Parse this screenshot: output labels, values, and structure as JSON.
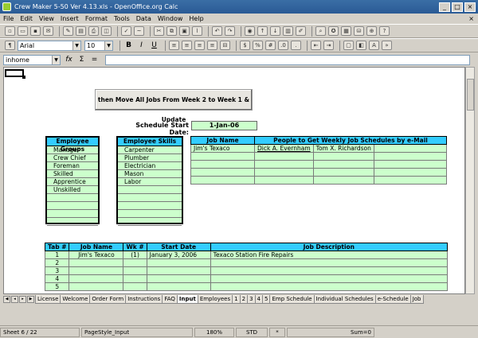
{
  "window": {
    "title": "Crew Maker 5-50 Ver 4.13.xls - OpenOffice.org Calc",
    "minimize": "_",
    "maximize": "□",
    "close": "×"
  },
  "menu": [
    "File",
    "Edit",
    "View",
    "Insert",
    "Format",
    "Tools",
    "Data",
    "Window",
    "Help"
  ],
  "menu_close": "×",
  "toolbar": {
    "font_name": "Arial",
    "font_size": "10",
    "bold": "B",
    "italic": "I",
    "underline": "U"
  },
  "formula_bar": {
    "name_box": "inhome",
    "fx": "fx",
    "sum": "Σ",
    "equals": "="
  },
  "sheet": {
    "move_button": "then Move All Jobs From Week 2 to Week 1 & Update",
    "schedule_start_label": "Schedule Start Date:",
    "schedule_start_value": "1-Jan-06",
    "employee_groups": {
      "header": "Employee Groups",
      "items": [
        "Manager",
        "Crew Chief",
        "Foreman",
        "Skilled",
        "Apprentice",
        "Unskilled",
        "",
        "",
        "",
        ""
      ]
    },
    "employee_skills": {
      "header": "Employee Skills",
      "items": [
        "Carpenter",
        "Plumber",
        "Electrician",
        "Mason",
        "Labor",
        "",
        "",
        "",
        "",
        ""
      ]
    },
    "jobs": {
      "headers": [
        "Job Name",
        "People to Get Weekly Job Schedules by e-Mail"
      ],
      "rows": [
        [
          "Jim's Texaco",
          "Dick A. Evernham",
          "Tom X. Richardson",
          ""
        ],
        [
          "",
          "",
          "",
          ""
        ],
        [
          "",
          "",
          "",
          ""
        ],
        [
          "",
          "",
          "",
          ""
        ],
        [
          "",
          "",
          "",
          ""
        ]
      ]
    },
    "tabs_table": {
      "headers": [
        "Tab #",
        "Job Name",
        "Wk #",
        "Start Date",
        "Job Description"
      ],
      "rows": [
        [
          "1",
          "Jim's Texaco",
          "(1)",
          "January 3, 2006",
          "Texaco Station Fire Repairs"
        ],
        [
          "2",
          "",
          "",
          "",
          ""
        ],
        [
          "3",
          "",
          "",
          "",
          ""
        ],
        [
          "4",
          "",
          "",
          "",
          ""
        ],
        [
          "5",
          "",
          "",
          "",
          ""
        ]
      ]
    }
  },
  "sheet_tabs": [
    "License",
    "Welcome",
    "Order Form",
    "Instructions",
    "FAQ",
    "Input",
    "Employees",
    "1",
    "2",
    "3",
    "4",
    "5",
    "Emp Schedule",
    "Individual Schedules",
    "e-Schedule",
    "Job"
  ],
  "active_tab": "Input",
  "status": {
    "sheet": "Sheet 6 / 22",
    "page_style": "PageStyle_Input",
    "zoom": "180%",
    "mode": "STD",
    "modified": "*",
    "sum": "Sum=0"
  }
}
